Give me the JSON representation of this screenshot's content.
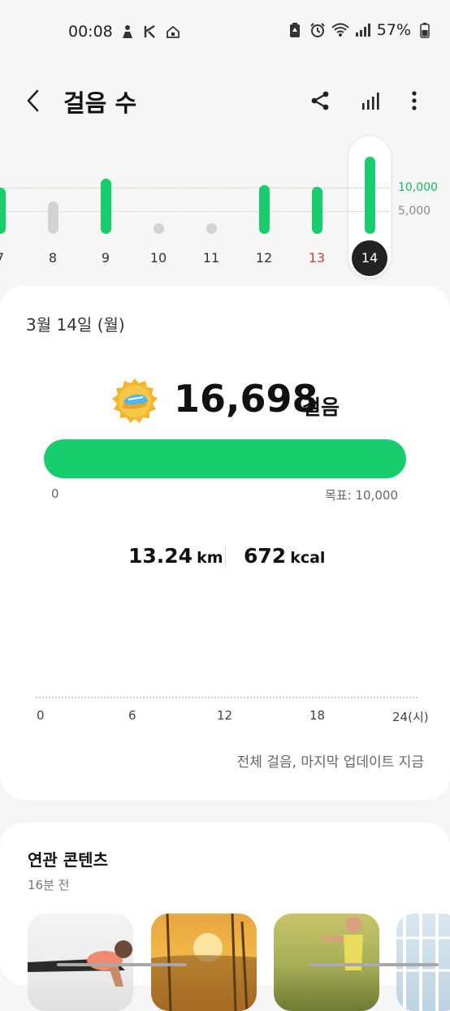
{
  "status_bar": {
    "time": "00:08",
    "battery": "57%",
    "left_icons": [
      "person-icon",
      "app-icon",
      "home-icon"
    ],
    "right_icons": [
      "battery-saver-icon",
      "alarm-icon",
      "wifi-icon",
      "signal-icon",
      "battery-icon"
    ]
  },
  "header": {
    "title": "걸음 수",
    "actions": [
      "share-icon",
      "chart-icon",
      "more-icon"
    ]
  },
  "daily_chart": {
    "goal_label": "10,000",
    "half_label": "5,000",
    "days": [
      {
        "label": "7",
        "steps": 10000,
        "goal_met": true
      },
      {
        "label": "8",
        "steps": 7000,
        "goal_met": false
      },
      {
        "label": "9",
        "steps": 12000,
        "goal_met": true
      },
      {
        "label": "10",
        "steps": 0,
        "goal_met": false
      },
      {
        "label": "11",
        "steps": 0,
        "goal_met": false
      },
      {
        "label": "12",
        "steps": 10500,
        "goal_met": true
      },
      {
        "label": "13",
        "steps": 10200,
        "goal_met": true
      },
      {
        "label": "14",
        "steps": 16698,
        "goal_met": true
      }
    ],
    "colors": {
      "goal": "#18cd6d",
      "below_goal": "#d2d2d2",
      "sunday_label": "#c9443a",
      "selected": "#222222"
    }
  },
  "summary": {
    "date": "3월 14일 (월)",
    "steps": "16,698",
    "steps_unit": "걸음",
    "progress": 1.0,
    "progress_min": "0",
    "goal_text": "목표: 10,000",
    "distance_value": "13.24",
    "distance_unit": "km",
    "calories_value": "672",
    "calories_unit": "kcal",
    "hour_labels": [
      "0",
      "6",
      "12",
      "18",
      "24(시)"
    ],
    "update_note": "전체 걸음, 마지막 업데이트 지금"
  },
  "related": {
    "title": "연관 콘텐츠",
    "time": "16분 전"
  }
}
